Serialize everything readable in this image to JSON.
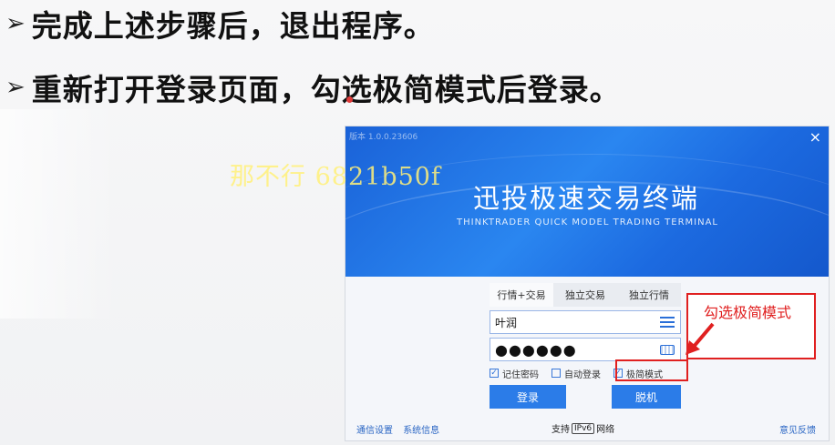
{
  "slide": {
    "bullets": [
      {
        "arrow": "➢",
        "text": "完成上述步骤后，退出程序。"
      },
      {
        "arrow": "➢",
        "text": "重新打开登录页面，勾选极简模式后登录。"
      }
    ],
    "watermark": "那不行 6821b50f"
  },
  "login_window": {
    "version": "版本 1.0.0.23606",
    "close": "×",
    "title": "迅投极速交易终端",
    "subtitle": "THINKTRADER QUICK MODEL TRADING TERMINAL",
    "tabs": [
      "行情+交易",
      "独立交易",
      "独立行情"
    ],
    "username": {
      "value": "叶润",
      "icon": "menu-icon"
    },
    "password": {
      "value": "●●●●●●",
      "icon": "keyboard-icon"
    },
    "checkboxes": [
      {
        "label": "记住密码",
        "checked": true,
        "mark": "✓"
      },
      {
        "label": "自动登录",
        "checked": false,
        "mark": ""
      },
      {
        "label": "极简模式",
        "checked": true,
        "mark": "✓"
      }
    ],
    "login_button": "登录",
    "offline_button": "脱机",
    "footer": {
      "settings": "通信设置",
      "sysinfo": "系统信息",
      "support_pre": "支持",
      "ipv6": "IPv6",
      "support_post": "网络",
      "feedback": "意见反馈"
    }
  },
  "annotation": {
    "callout_text": "勾选极简模式",
    "color": "#e02020"
  }
}
